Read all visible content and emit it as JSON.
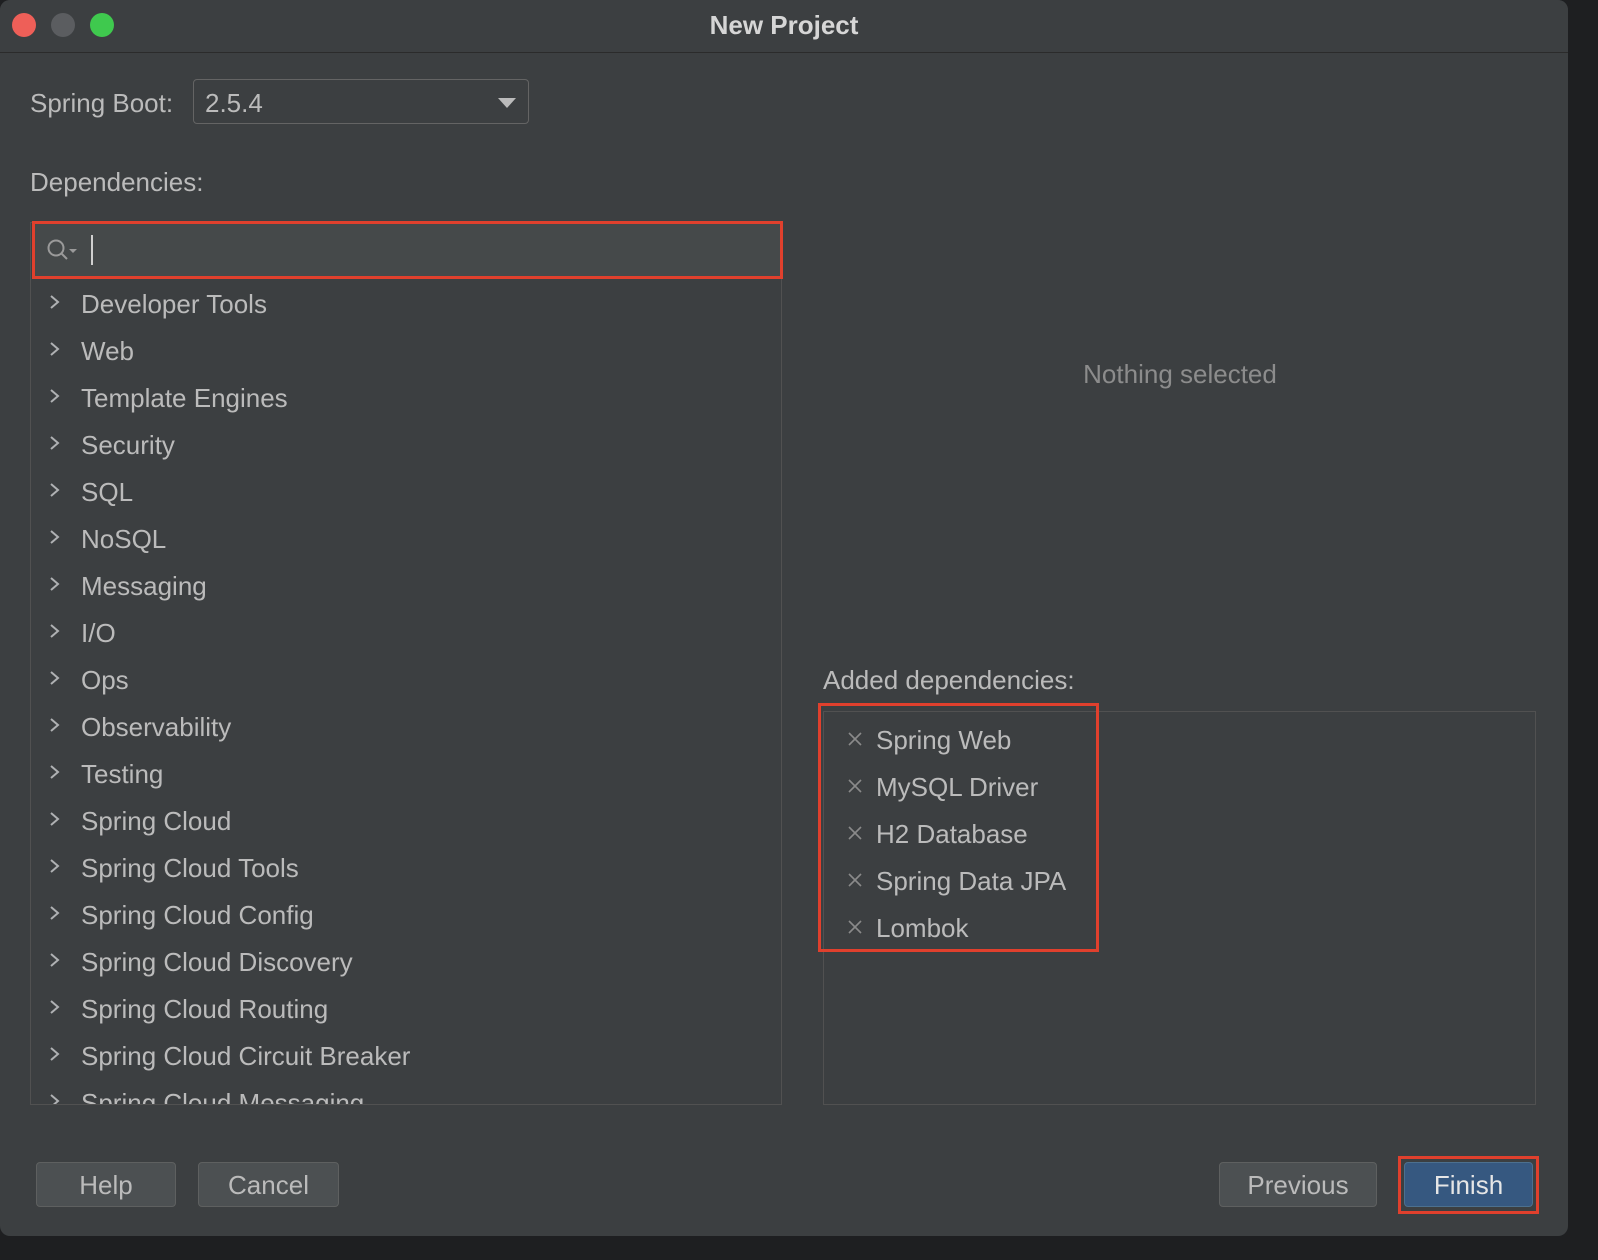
{
  "window": {
    "title": "New Project"
  },
  "spring_boot": {
    "label": "Spring Boot:",
    "value": "2.5.4"
  },
  "dependencies": {
    "label": "Dependencies:",
    "search": {
      "value": "",
      "placeholder": ""
    },
    "categories": [
      "Developer Tools",
      "Web",
      "Template Engines",
      "Security",
      "SQL",
      "NoSQL",
      "Messaging",
      "I/O",
      "Ops",
      "Observability",
      "Testing",
      "Spring Cloud",
      "Spring Cloud Tools",
      "Spring Cloud Config",
      "Spring Cloud Discovery",
      "Spring Cloud Routing",
      "Spring Cloud Circuit Breaker",
      "Spring Cloud Messaging"
    ]
  },
  "details": {
    "empty_text": "Nothing selected"
  },
  "added": {
    "label": "Added dependencies:",
    "items": [
      "Spring Web",
      "MySQL Driver",
      "H2 Database",
      "Spring Data JPA",
      "Lombok"
    ]
  },
  "buttons": {
    "help": "Help",
    "cancel": "Cancel",
    "previous": "Previous",
    "finish": "Finish"
  },
  "colors": {
    "background": "#3c3f41",
    "highlight": "#e0402d",
    "primary_button": "#365880"
  }
}
